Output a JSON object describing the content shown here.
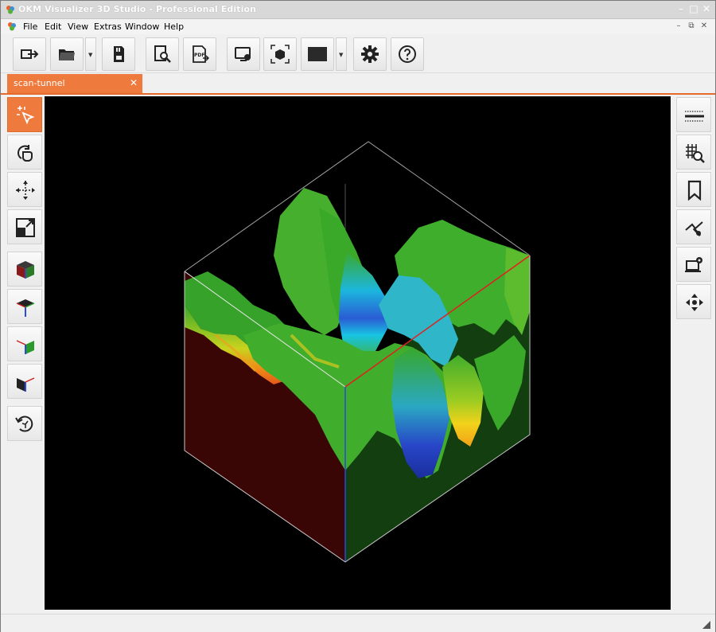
{
  "window": {
    "title": "OKM Visualizer 3D Studio - Professional Edition",
    "minimize": "–",
    "maximize": "□",
    "close": "✕"
  },
  "menu": {
    "items": [
      "File",
      "Edit",
      "View",
      "Extras",
      "Window",
      "Help"
    ],
    "doc_controls": [
      "–",
      "⧉",
      "✕"
    ]
  },
  "toolbar": {
    "buttons": [
      "import-icon",
      "open-folder-icon",
      "save-card-icon",
      "preview-search-icon",
      "export-pdf-icon",
      "screenshot-icon",
      "cube-select-icon",
      "color-swatch-icon",
      "settings-gear-icon",
      "help-icon"
    ]
  },
  "tabs": [
    {
      "label": "scan-tunnel",
      "close": "✕"
    }
  ],
  "left_tools": [
    "select-pointer-icon",
    "rotate-hand-icon",
    "move-arrows-icon",
    "zoom-fit-icon",
    "view-3d-cube-icon",
    "view-top-icon",
    "view-side-green-icon",
    "view-front-red-icon",
    "reset-view-icon"
  ],
  "right_tools": [
    "surface-filter-icon",
    "grid-zoom-icon",
    "bookmark-icon",
    "probe-tool-icon",
    "laptop-settings-icon",
    "navigation-icon"
  ],
  "colors": {
    "accent": "#ef7a3d",
    "viewport_bg": "#000000",
    "surface_green": "#3fae2c",
    "surface_blue": "#1e3cb4",
    "surface_cyan": "#18c0e8",
    "surface_yellow": "#f2d21a",
    "surface_orange": "#f07a14",
    "wall_red": "#3a0505",
    "wall_green": "#123e10"
  }
}
